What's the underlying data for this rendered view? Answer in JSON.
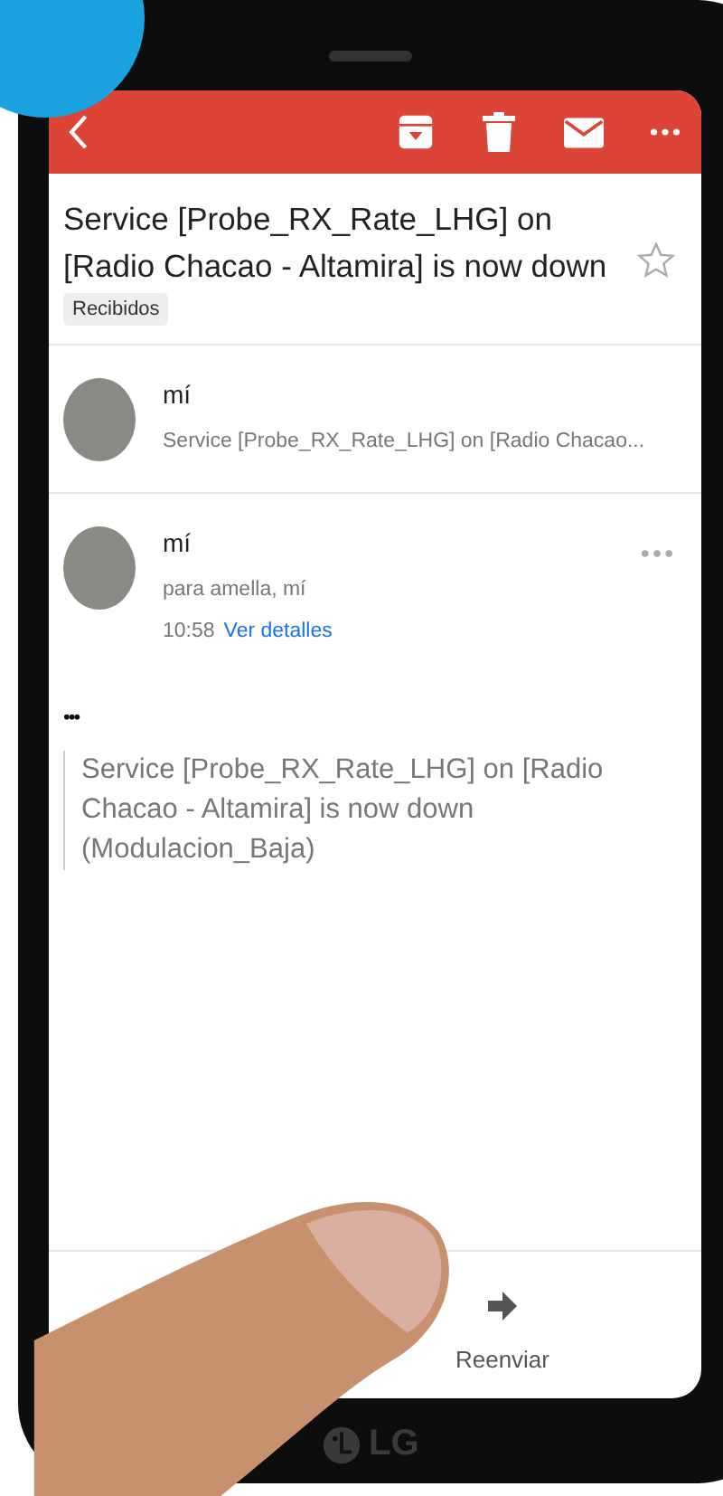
{
  "subject": {
    "text": "Service [Probe_RX_Rate_LHG] on [Radio Chacao - Altamira] is now down",
    "label": "Recibidos",
    "starred": false
  },
  "messages": [
    {
      "kind": "collapsed",
      "sender": "mí",
      "snippet": "Service [Probe_RX_Rate_LHG] on [Radio Chacao..."
    },
    {
      "kind": "expanded",
      "sender": "mí",
      "recipients": "para amella, mí",
      "time": "10:58",
      "details_link": "Ver detalles"
    }
  ],
  "quoted_toggle": "•••",
  "body": "Service [Probe_RX_Rate_LHG] on [Radio Chacao - Altamira] is now down (Modulacion_Baja)",
  "actions": [
    {
      "label": "Reenviar"
    }
  ],
  "brand": "LG"
}
